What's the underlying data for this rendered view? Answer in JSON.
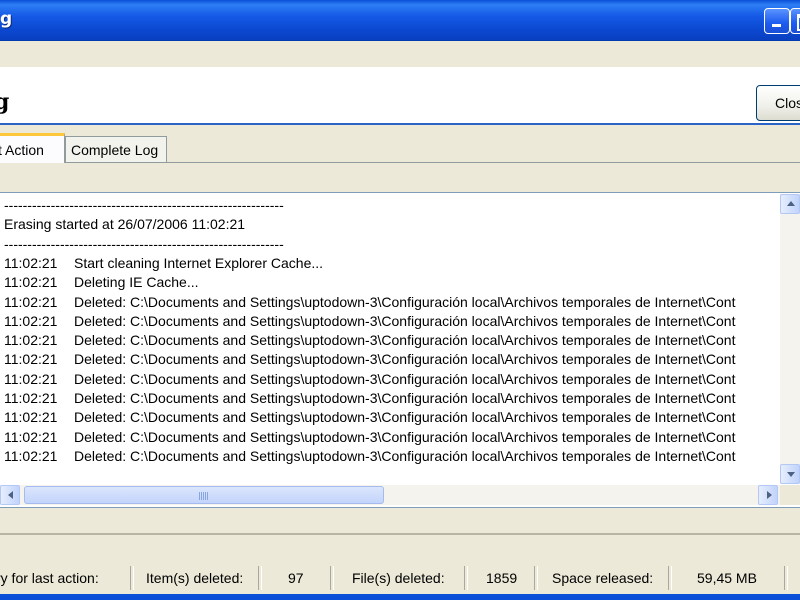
{
  "window": {
    "title_fragment": "g",
    "minimize_label": "Minimize",
    "maximize_label": "Maximize"
  },
  "header": {
    "title": "g",
    "close_button": "Clos"
  },
  "tabs": [
    {
      "label": "st Action",
      "active": true
    },
    {
      "label": "Complete Log",
      "active": false
    }
  ],
  "log": {
    "lines": [
      {
        "time": "",
        "message": "------------------------------------------------------------"
      },
      {
        "time": "",
        "message": "Erasing started at 26/07/2006  11:02:21"
      },
      {
        "time": "",
        "message": "------------------------------------------------------------"
      },
      {
        "time": "11:02:21",
        "message": "Start cleaning Internet Explorer Cache..."
      },
      {
        "time": "11:02:21",
        "message": "Deleting IE Cache..."
      },
      {
        "time": "11:02:21",
        "message": "Deleted: C:\\Documents and Settings\\uptodown-3\\Configuración local\\Archivos temporales de Internet\\Cont"
      },
      {
        "time": "11:02:21",
        "message": "Deleted: C:\\Documents and Settings\\uptodown-3\\Configuración local\\Archivos temporales de Internet\\Cont"
      },
      {
        "time": "11:02:21",
        "message": "Deleted: C:\\Documents and Settings\\uptodown-3\\Configuración local\\Archivos temporales de Internet\\Cont"
      },
      {
        "time": "11:02:21",
        "message": "Deleted: C:\\Documents and Settings\\uptodown-3\\Configuración local\\Archivos temporales de Internet\\Cont"
      },
      {
        "time": "11:02:21",
        "message": "Deleted: C:\\Documents and Settings\\uptodown-3\\Configuración local\\Archivos temporales de Internet\\Cont"
      },
      {
        "time": "11:02:21",
        "message": "Deleted: C:\\Documents and Settings\\uptodown-3\\Configuración local\\Archivos temporales de Internet\\Cont"
      },
      {
        "time": "11:02:21",
        "message": "Deleted: C:\\Documents and Settings\\uptodown-3\\Configuración local\\Archivos temporales de Internet\\Cont"
      },
      {
        "time": "11:02:21",
        "message": "Deleted: C:\\Documents and Settings\\uptodown-3\\Configuración local\\Archivos temporales de Internet\\Cont"
      },
      {
        "time": "11:02:21",
        "message": "Deleted: C:\\Documents and Settings\\uptodown-3\\Configuración local\\Archivos temporales de Internet\\Cont"
      }
    ]
  },
  "status": {
    "summary_label": "ry for last action:",
    "items_label": "Item(s) deleted:",
    "items_value": "97",
    "files_label": "File(s) deleted:",
    "files_value": "1859",
    "space_label": "Space released:",
    "space_value": "59,45 MB"
  },
  "colors": {
    "titlebar": "#0a4fd8",
    "tab_highlight": "#ffc83c",
    "header_rule": "#2b64c6"
  }
}
